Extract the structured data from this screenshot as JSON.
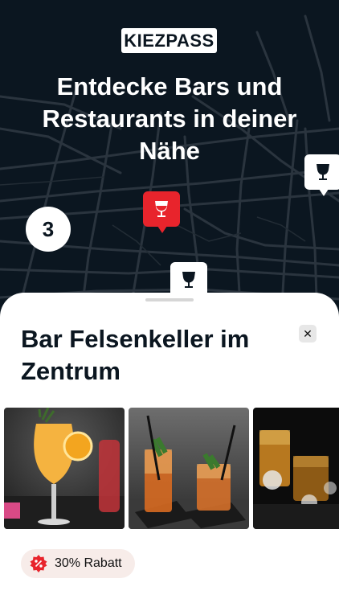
{
  "app": {
    "logo_text": "KIEZPASS",
    "headline": "Entdecke Bars und\nRestaurants in deiner\nNähe"
  },
  "map": {
    "cluster_count": "3",
    "pins": [
      {
        "type": "wine-glass",
        "style": "white"
      },
      {
        "type": "wine-glass",
        "style": "red-selected"
      },
      {
        "type": "wine-glass",
        "style": "white"
      }
    ],
    "colors": {
      "background": "#0b1620",
      "road": "#2a343e",
      "selected_pin": "#e8242c"
    }
  },
  "venue_sheet": {
    "title": "Bar Felsenkeller im Zentrum",
    "close_icon": "close-icon",
    "photos": [
      "orange-cocktail-photo",
      "two-cocktails-photo",
      "whiskey-glasses-photo"
    ],
    "discount_label": "30% Rabatt",
    "discount_icon": "discount-badge-icon"
  }
}
